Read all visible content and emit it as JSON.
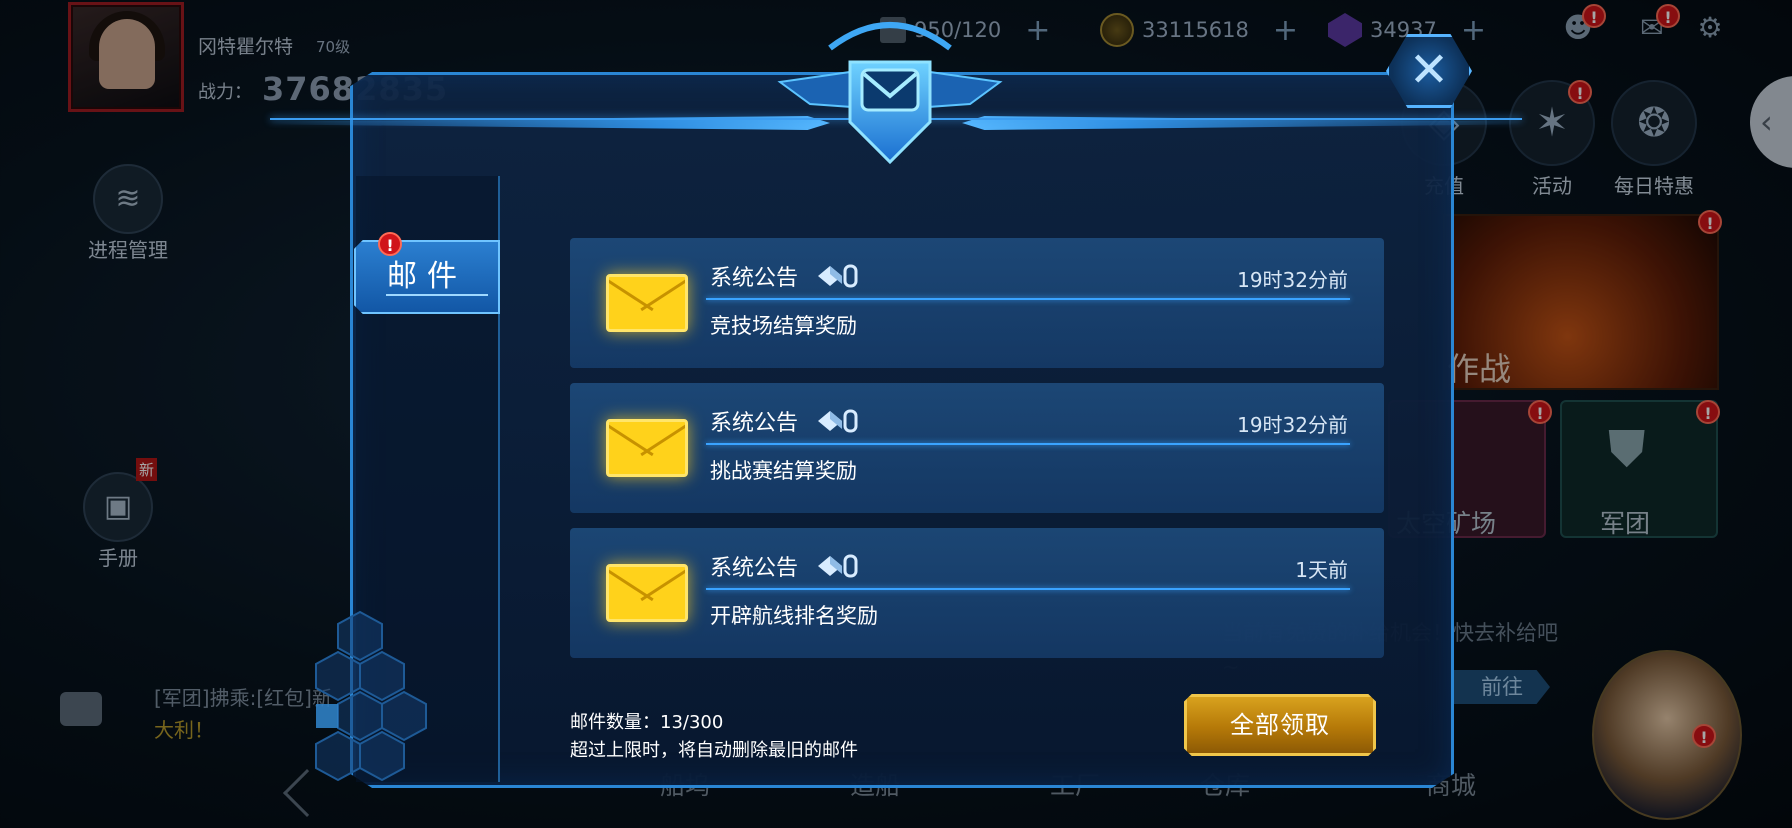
{
  "player": {
    "name": "冈特瞿尔特",
    "level": "70级",
    "power_label": "战力：",
    "power_value": "37682835"
  },
  "resources": [
    {
      "icon": "ship-count-icon",
      "value": "950/120"
    },
    {
      "icon": "gold-coin-icon",
      "value": "33115618"
    },
    {
      "icon": "purple-gem-icon",
      "value": "34937"
    }
  ],
  "top_icons": [
    "friends-icon",
    "mail-envelope-icon",
    "settings-gear-icon"
  ],
  "left_menu": [
    {
      "label": "进程管理",
      "icon": "layers-icon"
    },
    {
      "label": "手册",
      "icon": "handbook-icon",
      "badge": "新"
    }
  ],
  "right_features": [
    {
      "label": "充值",
      "icon": "recharge-icon"
    },
    {
      "label": "活动",
      "icon": "activity-icon"
    },
    {
      "label": "每日特惠",
      "icon": "daily-deal-icon"
    }
  ],
  "banner": {
    "label": "作战"
  },
  "tiles": [
    {
      "label": "太空矿场"
    },
    {
      "label": "军团"
    }
  ],
  "notice": {
    "text": "当前有免费的补给机会！快去补给吧~",
    "button": "前往"
  },
  "chat": {
    "line1": "[军团]拂乘:[红包]新",
    "line2": "大利！"
  },
  "bottom_nav": [
    "船坞",
    "造船",
    "工厂",
    "仓库",
    "商城"
  ],
  "dialog": {
    "close_icon": "close-x-icon",
    "emblem": "mail-emblem-icon",
    "tabs": [
      {
        "label": "邮件",
        "active": true,
        "badge": "!"
      }
    ],
    "mails": [
      {
        "title": "系统公告",
        "time": "19时32分前",
        "subject": "竞技场结算奖励",
        "has_attachment": true
      },
      {
        "title": "系统公告",
        "time": "19时32分前",
        "subject": "挑战赛结算奖励",
        "has_attachment": true
      },
      {
        "title": "系统公告",
        "time": "1天前",
        "subject": "开辟航线排名奖励",
        "has_attachment": true
      }
    ],
    "count_text": "邮件数量：13/300",
    "limit_text": "超过上限时，将自动删除最旧的邮件",
    "claim_all_label": "全部领取"
  },
  "colors": {
    "accent_blue": "#2a86d4",
    "envelope_yellow": "#ffd21b",
    "badge_red": "#d0141a",
    "claim_gold": "#d8a21e"
  }
}
